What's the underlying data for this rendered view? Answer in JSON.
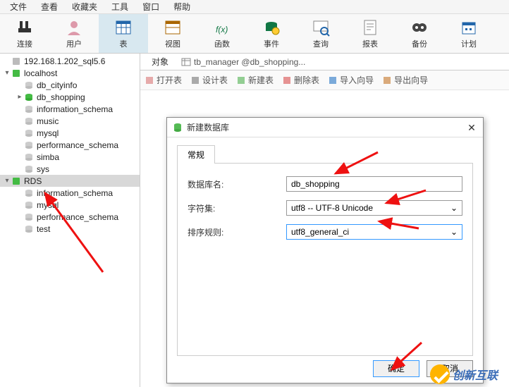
{
  "menu": [
    "文件",
    "查看",
    "收藏夹",
    "工具",
    "窗口",
    "帮助"
  ],
  "toolbar": [
    {
      "label": "连接",
      "icon": "plug"
    },
    {
      "label": "用户",
      "icon": "user"
    },
    {
      "label": "表",
      "icon": "table",
      "active": true
    },
    {
      "label": "视图",
      "icon": "view"
    },
    {
      "label": "函数",
      "icon": "fx"
    },
    {
      "label": "事件",
      "icon": "event"
    },
    {
      "label": "查询",
      "icon": "query"
    },
    {
      "label": "报表",
      "icon": "report"
    },
    {
      "label": "备份",
      "icon": "backup"
    },
    {
      "label": "计划",
      "icon": "schedule"
    }
  ],
  "tree": [
    {
      "indent": 0,
      "chev": "",
      "icon": "conn-gray",
      "label": "192.168.1.202_sql5.6"
    },
    {
      "indent": 0,
      "chev": "▾",
      "icon": "conn-green",
      "label": "localhost"
    },
    {
      "indent": 1,
      "chev": "",
      "icon": "db-gray",
      "label": "db_cityinfo"
    },
    {
      "indent": 1,
      "chev": "▸",
      "icon": "db-green",
      "label": "db_shopping"
    },
    {
      "indent": 1,
      "chev": "",
      "icon": "db-gray",
      "label": "information_schema"
    },
    {
      "indent": 1,
      "chev": "",
      "icon": "db-gray",
      "label": "music"
    },
    {
      "indent": 1,
      "chev": "",
      "icon": "db-gray",
      "label": "mysql"
    },
    {
      "indent": 1,
      "chev": "",
      "icon": "db-gray",
      "label": "performance_schema"
    },
    {
      "indent": 1,
      "chev": "",
      "icon": "db-gray",
      "label": "simba"
    },
    {
      "indent": 1,
      "chev": "",
      "icon": "db-gray",
      "label": "sys"
    },
    {
      "indent": 0,
      "chev": "▾",
      "icon": "conn-green",
      "label": "RDS",
      "selected": true
    },
    {
      "indent": 1,
      "chev": "",
      "icon": "db-gray",
      "label": "information_schema"
    },
    {
      "indent": 1,
      "chev": "",
      "icon": "db-gray",
      "label": "mysql"
    },
    {
      "indent": 1,
      "chev": "",
      "icon": "db-gray",
      "label": "performance_schema"
    },
    {
      "indent": 1,
      "chev": "",
      "icon": "db-gray",
      "label": "test"
    }
  ],
  "tabs": {
    "objects": "对象",
    "second": "tb_manager @db_shopping..."
  },
  "subtoolbar": [
    "打开表",
    "设计表",
    "新建表",
    "删除表",
    "导入向导",
    "导出向导"
  ],
  "dialog": {
    "title": "新建数据库",
    "tab": "常规",
    "fields": {
      "name_label": "数据库名:",
      "name_value": "db_shopping",
      "charset_label": "字符集:",
      "charset_value": "utf8 -- UTF-8 Unicode",
      "collate_label": "排序规则:",
      "collate_value": "utf8_general_ci"
    },
    "ok": "确定",
    "cancel": "取消"
  },
  "watermark": "创新互联"
}
